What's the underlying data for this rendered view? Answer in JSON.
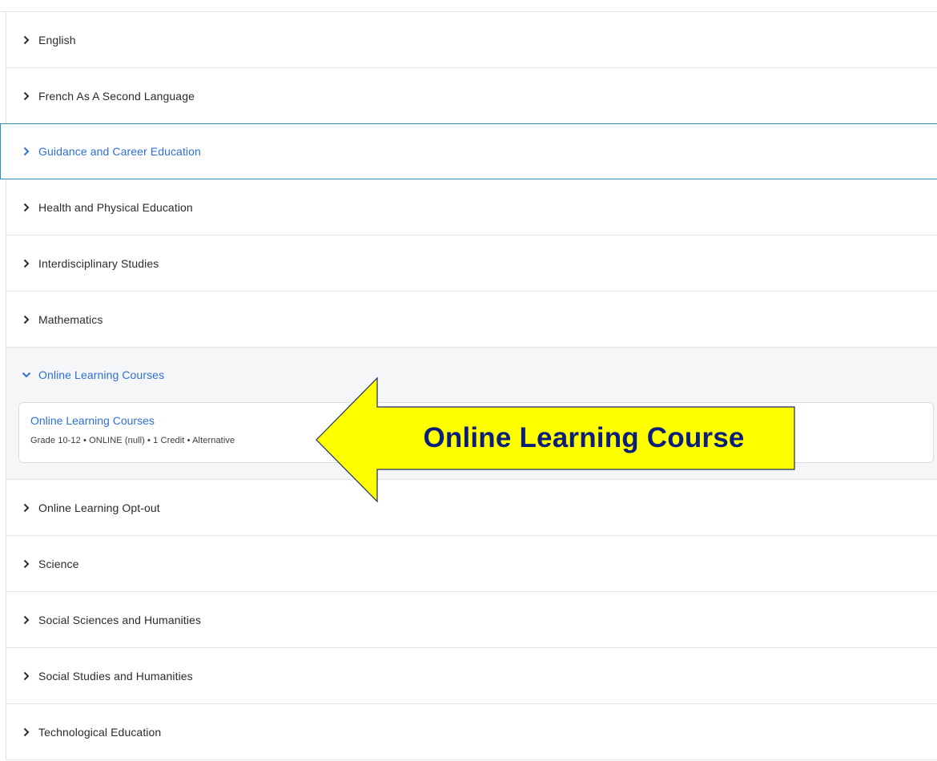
{
  "accordion": {
    "items": [
      {
        "label": "English"
      },
      {
        "label": "French As A Second Language"
      },
      {
        "label": "Guidance and Career Education"
      },
      {
        "label": "Health and Physical Education"
      },
      {
        "label": "Interdisciplinary Studies"
      },
      {
        "label": "Mathematics"
      },
      {
        "label": "Online Learning Courses"
      },
      {
        "label": "Online Learning Opt-out"
      },
      {
        "label": "Science"
      },
      {
        "label": "Social Sciences and Humanities"
      },
      {
        "label": "Social Studies and Humanities"
      },
      {
        "label": "Technological Education"
      }
    ],
    "expanded_course": {
      "title": "Online Learning Courses",
      "meta": "Grade 10-12 • ONLINE (null) • 1 Credit • Alternative"
    }
  },
  "annotation": {
    "text": "Online Learning Course"
  },
  "colors": {
    "link_blue": "#2f6fd3",
    "focus_border": "#2b8fb8",
    "callout_fill": "#ffff00",
    "callout_text": "#0b1f7a"
  },
  "icons": {
    "collapsed": "chevron-right-icon",
    "expanded": "chevron-down-icon"
  }
}
